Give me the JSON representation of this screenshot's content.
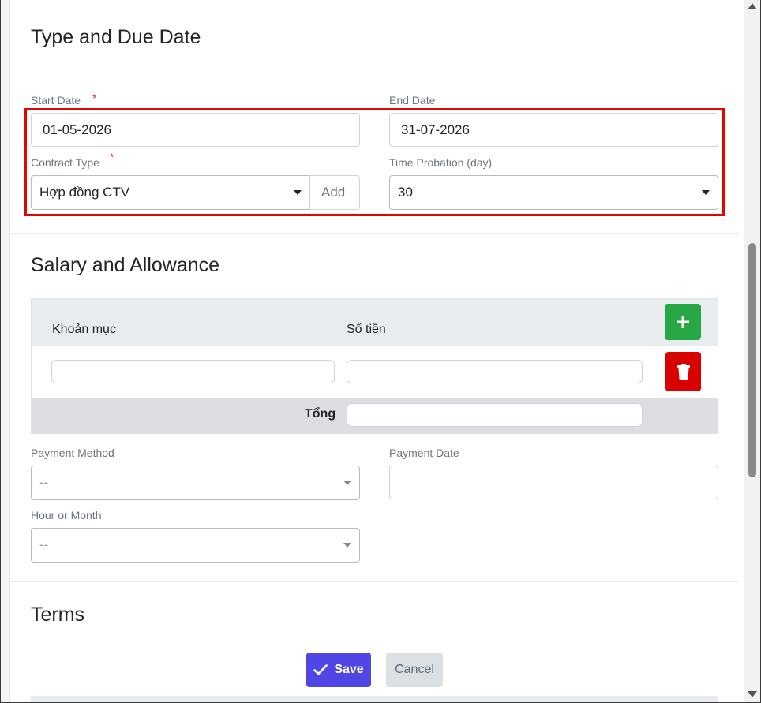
{
  "type_due": {
    "title": "Type and Due Date",
    "start_label": "Start Date",
    "start_required": "*",
    "start_value": "01-05-2026",
    "end_label": "End Date",
    "end_value": "31-07-2026",
    "contract_label": "Contract Type",
    "contract_required": "*",
    "contract_value": "Hợp đồng CTV",
    "add_label": "Add",
    "probation_label": "Time Probation (day)",
    "probation_value": "30"
  },
  "salary": {
    "title": "Salary and Allowance",
    "col_item": "Khoản mục",
    "col_amount": "Số tiền",
    "add_icon": "plus-icon",
    "delete_icon": "trash-icon",
    "total_label": "Tổng",
    "payment_method_label": "Payment Method",
    "payment_method_value": "--",
    "payment_date_label": "Payment Date",
    "hour_month_label": "Hour or Month",
    "hour_month_value": "--"
  },
  "terms": {
    "title": "Terms"
  },
  "actions": {
    "save_label": "Save",
    "cancel_label": "Cancel"
  },
  "colors": {
    "save": "#4f46e5",
    "add": "#28a745",
    "delete": "#d90000",
    "highlight": "#e10600"
  }
}
